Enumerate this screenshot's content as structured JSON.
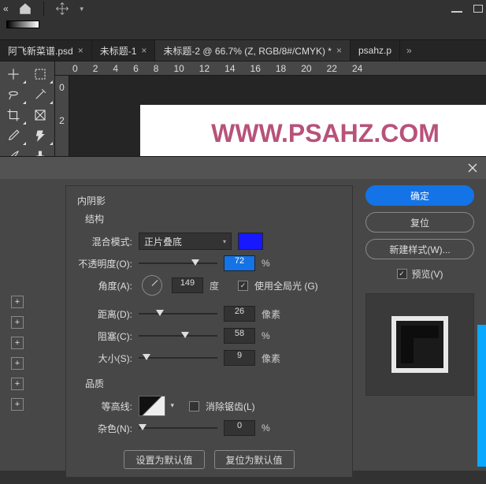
{
  "tabs": {
    "t1": "阿飞新菜谱.psd",
    "t2": "未标题-1",
    "t3": "未标题-2 @ 66.7% (Z, RGB/8#/CMYK) *",
    "t4": "psahz.p"
  },
  "rulerH": [
    "0",
    "2",
    "4",
    "6",
    "8",
    "10",
    "12",
    "14",
    "16",
    "18",
    "20",
    "22",
    "24"
  ],
  "rulerV": [
    "0",
    "2"
  ],
  "watermark": "WWW.PSAHZ.COM",
  "dlg": {
    "title": "内阴影",
    "section1": "结构",
    "blendModeLbl": "混合模式:",
    "blendModeVal": "正片叠底",
    "opacityLbl": "不透明度(O):",
    "opacityVal": "72",
    "pct": "%",
    "angleLbl": "角度(A):",
    "angleVal": "149",
    "deg": "度",
    "globalLight": "使用全局光 (G)",
    "distanceLbl": "距离(D):",
    "distanceVal": "26",
    "px": "像素",
    "chokeLbl": "阻塞(C):",
    "chokeVal": "58",
    "sizeLbl": "大小(S):",
    "sizeVal": "9",
    "section2": "品质",
    "contourLbl": "等高线:",
    "antialias": "消除锯齿(L)",
    "noiseLbl": "杂色(N):",
    "noiseVal": "0",
    "setDefault": "设置为默认值",
    "resetDefault": "复位为默认值"
  },
  "right": {
    "ok": "确定",
    "cancel": "复位",
    "newStyle": "新建样式(W)...",
    "preview": "预览(V)"
  }
}
